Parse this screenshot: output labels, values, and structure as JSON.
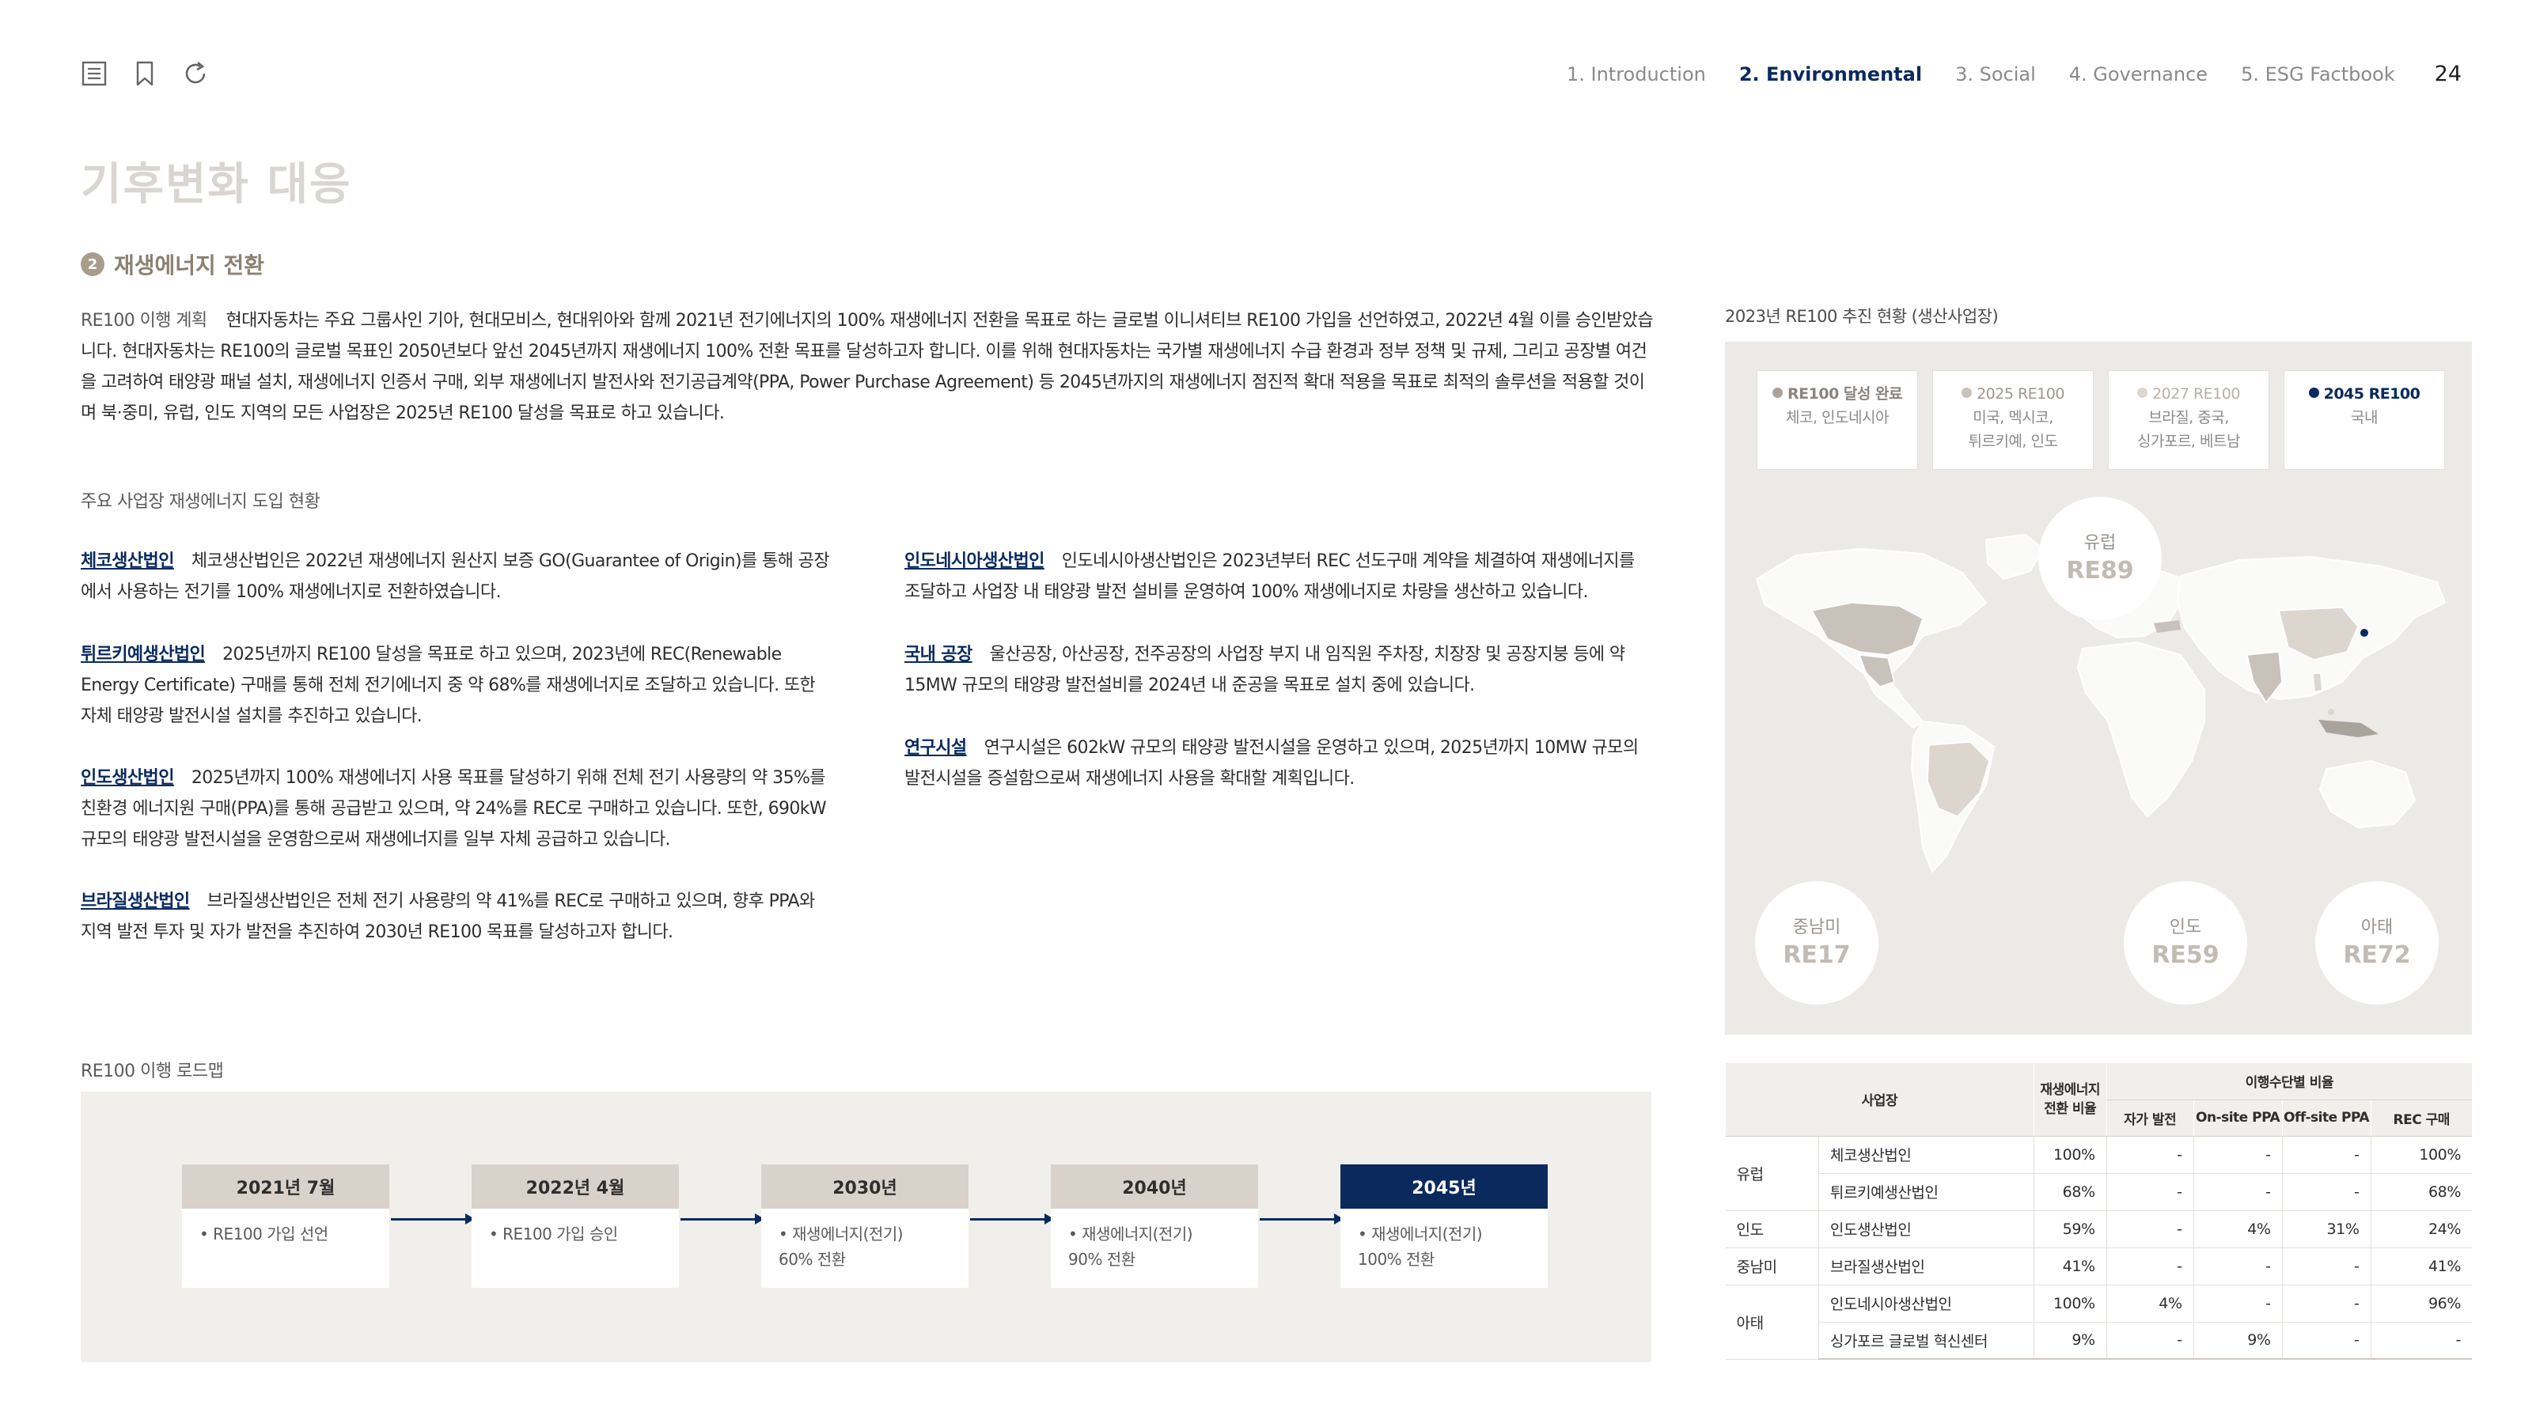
{
  "nav": {
    "items": [
      "1. Introduction",
      "2. Environmental",
      "3. Social",
      "4. Governance",
      "5. ESG Factbook"
    ],
    "page": "24"
  },
  "page_title": "기후변화 대응",
  "section": {
    "num": "2",
    "title": "재생에너지 전환"
  },
  "intro": {
    "label": "RE100 이행 계획",
    "text": "현대자동차는 주요 그룹사인 기아, 현대모비스, 현대위아와 함께 2021년 전기에너지의 100% 재생에너지 전환을 목표로 하는 글로벌 이니셔티브 RE100 가입을 선언하였고, 2022년 4월 이를 승인받았습니다. 현대자동차는 RE100의 글로벌 목표인 2050년보다 앞선 2045년까지 재생에너지 100% 전환 목표를 달성하고자 합니다. 이를 위해 현대자동차는 국가별 재생에너지 수급 환경과 정부 정책 및 규제, 그리고 공장별 여건을 고려하여 태양광 패널 설치, 재생에너지 인증서 구매, 외부 재생에너지 발전사와 전기공급계약(PPA, Power Purchase Agreement) 등 2045년까지의 재생에너지 점진적 확대 적용을 목표로 최적의 솔루션을 적용할 것이며 북·중미, 유럽, 인도 지역의 모든 사업장은 2025년 RE100 달성을 목표로 하고 있습니다."
  },
  "sites_heading": "주요 사업장 재생에너지 도입 현황",
  "sites_left": [
    {
      "name": "체코생산법인",
      "text": "체코생산법인은 2022년 재생에너지 원산지 보증 GO(Guarantee of Origin)를 통해 공장에서 사용하는 전기를 100% 재생에너지로 전환하였습니다."
    },
    {
      "name": "튀르키예생산법인",
      "text": "2025년까지 RE100 달성을 목표로 하고 있으며, 2023년에 REC(Renewable Energy Certificate) 구매를 통해 전체 전기에너지 중 약 68%를 재생에너지로 조달하고 있습니다. 또한 자체 태양광 발전시설 설치를 추진하고 있습니다."
    },
    {
      "name": "인도생산법인",
      "text": "2025년까지 100% 재생에너지 사용 목표를 달성하기 위해 전체 전기 사용량의 약 35%를 친환경 에너지원 구매(PPA)를 통해 공급받고 있으며, 약 24%를 REC로 구매하고 있습니다. 또한, 690kW 규모의 태양광 발전시설을 운영함으로써 재생에너지를 일부 자체 공급하고 있습니다."
    },
    {
      "name": "브라질생산법인",
      "text": "브라질생산법인은 전체 전기 사용량의 약 41%를 REC로 구매하고 있으며, 향후 PPA와 지역 발전 투자 및 자가 발전을 추진하여 2030년 RE100 목표를 달성하고자 합니다."
    }
  ],
  "sites_right": [
    {
      "name": "인도네시아생산법인",
      "text": "인도네시아생산법인은 2023년부터 REC 선도구매 계약을 체결하여 재생에너지를 조달하고 사업장 내 태양광 발전 설비를 운영하여 100% 재생에너지로 차량을 생산하고 있습니다."
    },
    {
      "name": "국내 공장",
      "text": "울산공장, 아산공장, 전주공장의 사업장 부지 내 임직원 주차장, 치장장 및 공장지붕 등에 약 15MW 규모의 태양광 발전설비를 2024년 내 준공을 목표로 설치 중에 있습니다."
    },
    {
      "name": "연구시설",
      "text": "연구시설은 602kW 규모의 태양광 발전시설을 운영하고 있으며, 2025년까지 10MW 규모의 발전시설을 증설함으로써 재생에너지 사용을 확대할 계획입니다."
    }
  ],
  "roadmap": {
    "title": "RE100 이행 로드맵",
    "steps": [
      {
        "date": "2021년 7월",
        "desc": "• RE100 가입 선언"
      },
      {
        "date": "2022년 4월",
        "desc": "• RE100 가입 승인"
      },
      {
        "date": "2030년",
        "desc": "• 재생에너지(전기)\n  60% 전환"
      },
      {
        "date": "2040년",
        "desc": "• 재생에너지(전기)\n  90% 전환"
      },
      {
        "date": "2045년",
        "desc": "• 재생에너지(전기)\n  100% 전환"
      }
    ]
  },
  "map": {
    "title": "2023년 RE100 추진 현황 (생산사업장)",
    "legend": [
      {
        "title": "RE100 달성 완료",
        "regions": "체코, 인도네시아",
        "color": "#a9a39c"
      },
      {
        "title": "2025 RE100",
        "regions": "미국, 멕시코,\n튀르키예, 인도",
        "color": "#c9c2ba"
      },
      {
        "title": "2027 RE100",
        "regions": "브라질, 중국,\n싱가포르, 베트남",
        "color": "#ddd6ce"
      },
      {
        "title": "2045 RE100",
        "regions": "국내",
        "color": "#0a2a5e"
      }
    ],
    "bubbles": [
      {
        "region": "유럽",
        "value": "RE89"
      },
      {
        "region": "중남미",
        "value": "RE17"
      },
      {
        "region": "인도",
        "value": "RE59"
      },
      {
        "region": "아태",
        "value": "RE72"
      }
    ]
  },
  "table": {
    "h_site": "사업장",
    "h_ratio": "재생에너지\n전환 비율",
    "h_group": "이행수단별 비율",
    "h_sub": [
      "자가 발전",
      "On-site PPA",
      "Off-site PPA",
      "REC 구매"
    ],
    "rows": [
      {
        "region": "유럽",
        "site": "체코생산법인",
        "ratio": "100%",
        "self": "-",
        "onsite": "-",
        "offsite": "-",
        "rec": "100%"
      },
      {
        "region": "",
        "site": "튀르키예생산법인",
        "ratio": "68%",
        "self": "-",
        "onsite": "-",
        "offsite": "-",
        "rec": "68%"
      },
      {
        "region": "인도",
        "site": "인도생산법인",
        "ratio": "59%",
        "self": "-",
        "onsite": "4%",
        "offsite": "31%",
        "rec": "24%"
      },
      {
        "region": "중남미",
        "site": "브라질생산법인",
        "ratio": "41%",
        "self": "-",
        "onsite": "-",
        "offsite": "-",
        "rec": "41%"
      },
      {
        "region": "아태",
        "site": "인도네시아생산법인",
        "ratio": "100%",
        "self": "4%",
        "onsite": "-",
        "offsite": "-",
        "rec": "96%"
      },
      {
        "region": "",
        "site": "싱가포르 글로벌 혁신센터",
        "ratio": "9%",
        "self": "-",
        "onsite": "9%",
        "offsite": "-",
        "rec": "-"
      }
    ]
  }
}
